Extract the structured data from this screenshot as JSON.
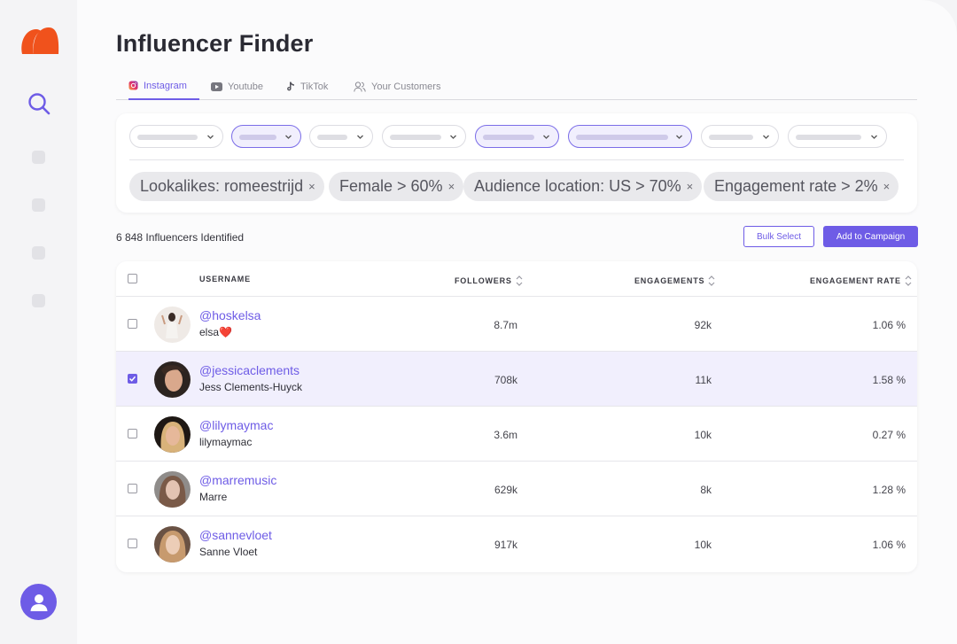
{
  "app": {
    "page_title": "Influencer Finder",
    "accent_color": "#6e5ce6",
    "logo_color": "#f0521c"
  },
  "tabs": [
    {
      "label": "Instagram",
      "icon": "instagram-icon",
      "active": true
    },
    {
      "label": "Youtube",
      "icon": "youtube-icon",
      "active": false
    },
    {
      "label": "TikTok",
      "icon": "tiktok-icon",
      "active": false
    },
    {
      "label": "Your Customers",
      "icon": "users-icon",
      "active": false
    }
  ],
  "filter_chips": [
    {
      "label": "Lookalikes: romeestrijd",
      "remove": "×"
    },
    {
      "label": "Female > 60%",
      "remove": "×"
    },
    {
      "label": "Audience location: US > 70%",
      "remove": "×"
    },
    {
      "label": "Engagement rate > 2%",
      "remove": "×"
    }
  ],
  "results": {
    "count_text": "6 848 Influencers Identified",
    "bulk_select_label": "Bulk Select",
    "add_to_campaign_label": "Add to Campaign"
  },
  "table": {
    "headers": {
      "username": "USERNAME",
      "followers": "FOLLOWERS",
      "engagements": "ENGAGEMENTS",
      "engagement_rate": "ENGAGEMENT RATE"
    },
    "rows": [
      {
        "handle": "@hoskelsa",
        "name": "elsa❤️",
        "followers": "8.7m",
        "engagements": "92k",
        "rate": "1.06 %",
        "checked": false
      },
      {
        "handle": "@jessicaclements",
        "name": "Jess Clements-Huyck",
        "followers": "708k",
        "engagements": "11k",
        "rate": "1.58 %",
        "checked": true
      },
      {
        "handle": "@lilymaymac",
        "name": "lilymaymac",
        "followers": "3.6m",
        "engagements": "10k",
        "rate": "0.27 %",
        "checked": false
      },
      {
        "handle": "@marremusic",
        "name": "Marre",
        "followers": "629k",
        "engagements": "8k",
        "rate": "1.28 %",
        "checked": false
      },
      {
        "handle": "@sannevloet",
        "name": "Sanne Vloet",
        "followers": "917k",
        "engagements": "10k",
        "rate": "1.06 %",
        "checked": false
      }
    ]
  }
}
